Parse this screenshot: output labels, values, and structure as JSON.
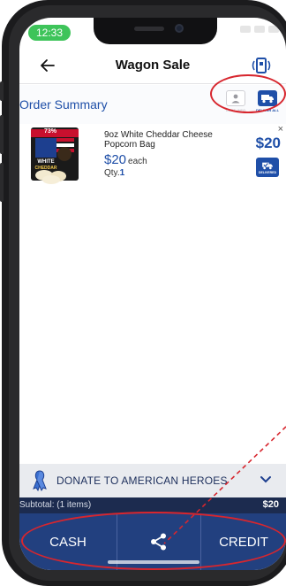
{
  "status": {
    "time": "12:33"
  },
  "header": {
    "title": "Wagon Sale",
    "back_icon": "arrow-left-icon",
    "device_icon": "card-reader-icon"
  },
  "order_summary": {
    "title": "Order Summary",
    "cust_info_label": "CUST. INFO",
    "deliver_all_label": "DELIVER ALL"
  },
  "item": {
    "name": "9oz White Cheddar Cheese Popcorn Bag",
    "unit_price": "$20",
    "each_label": "each",
    "qty_label": "Qty.",
    "qty": "1",
    "total": "$20",
    "remove": "×",
    "deliver_label": "DELIVERED",
    "thumb": {
      "banner": "73%",
      "brand_top": "WHITE",
      "brand_bottom": "CHEDDAR"
    }
  },
  "donate": {
    "label": "DONATE TO AMERICAN HEROES",
    "icon": "ribbon-icon"
  },
  "subtotal": {
    "label": "Subtotal: (1 items)",
    "value": "$20"
  },
  "payment": {
    "cash": "CASH",
    "share_icon": "share-icon",
    "credit": "CREDIT"
  },
  "colors": {
    "primary": "#1f4fa8",
    "navy": "#22407f",
    "highlight": "#d7262e",
    "status_green": "#3ec45a"
  }
}
